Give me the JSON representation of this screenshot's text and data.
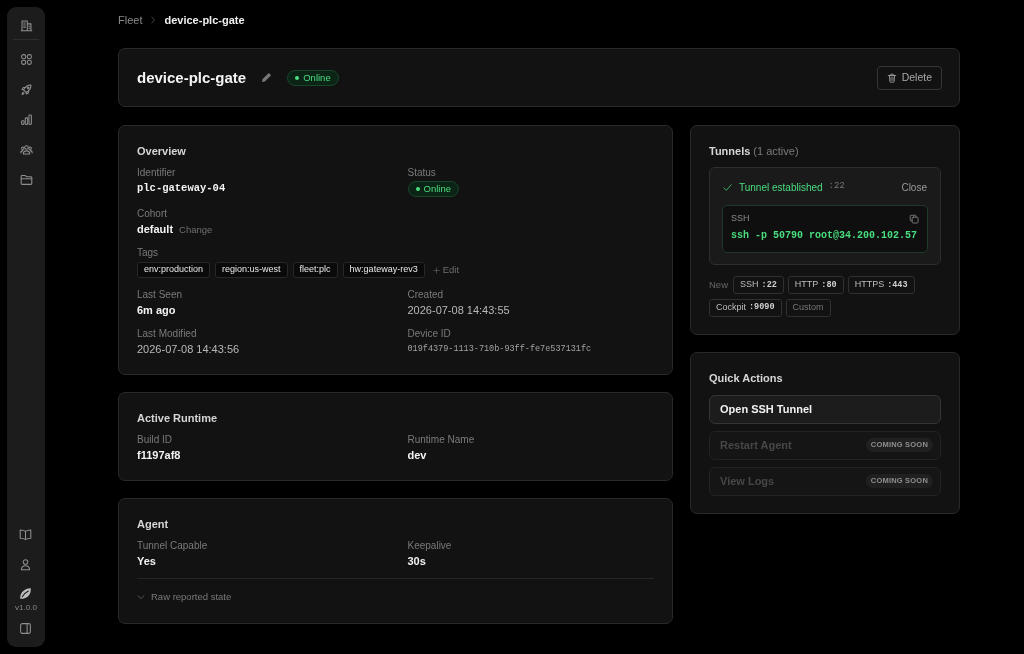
{
  "sidebar": {
    "version": "v1.0.0"
  },
  "breadcrumb": [
    {
      "label": "Fleet",
      "current": false
    },
    {
      "label": "device-plc-gate",
      "current": true
    }
  ],
  "header": {
    "title": "device-plc-gate",
    "status": "Online",
    "delete_button": "Delete"
  },
  "overview": {
    "title": "Overview",
    "rows": [
      [
        {
          "label": "Identifier",
          "value": "plc-gateway-04",
          "kind": "mono"
        },
        {
          "label": "Status",
          "value": "Online",
          "kind": "status"
        }
      ],
      [
        {
          "label": "Cohort",
          "value": "default",
          "kind": "text",
          "action": "Change"
        }
      ],
      [
        {
          "label": "Tags",
          "kind": "tags",
          "tags": [
            "env:production",
            "region:us-west",
            "fleet:plc",
            "hw:gateway-rev3"
          ],
          "action": "Edit"
        }
      ],
      [
        {
          "label": "Last Seen",
          "value": "6m ago",
          "kind": "text"
        },
        {
          "label": "Created",
          "value": "2026-07-08 14:43:55",
          "kind": "muted"
        }
      ],
      [
        {
          "label": "Last Modified",
          "value": "2026-07-08 14:43:56",
          "kind": "muted"
        },
        {
          "label": "Device ID",
          "value": "019f4379-1113-710b-93ff-fe7e537131fc",
          "kind": "code"
        }
      ]
    ]
  },
  "active_runtime": {
    "title": "Active Runtime",
    "rows": [
      [
        {
          "label": "Build ID",
          "value": "f1197af8",
          "kind": "text"
        },
        {
          "label": "Runtime Name",
          "value": "dev",
          "kind": "text"
        }
      ]
    ]
  },
  "agent": {
    "title": "Agent",
    "rows": [
      [
        {
          "label": "Tunnel Capable",
          "value": "Yes",
          "kind": "text"
        },
        {
          "label": "Keepalive",
          "value": "30s",
          "kind": "text"
        }
      ]
    ],
    "raw_state": {
      "label": "Raw reported state",
      "expanded": false
    }
  },
  "tunnels": {
    "title": "Tunnels",
    "count": "(1 active)",
    "active_tunnels": [
      {
        "status": "Tunnel established",
        "port": ":22",
        "close": "Close",
        "protocol": "SSH",
        "command": "ssh -p 50790 root@34.200.102.57"
      }
    ],
    "new_label": "New",
    "new_options": [
      {
        "label": "SSH",
        "port": ":22",
        "kind": "port"
      },
      {
        "label": "HTTP",
        "port": ":80",
        "kind": "port"
      },
      {
        "label": "HTTPS",
        "port": ":443",
        "kind": "port"
      },
      {
        "label": "Cockpit",
        "port": ":9090",
        "kind": "port"
      },
      {
        "label": "Custom",
        "kind": "custom"
      }
    ]
  },
  "quick_actions": {
    "title": "Quick Actions",
    "actions": [
      {
        "label": "Open SSH Tunnel",
        "disabled": false
      },
      {
        "label": "Restart Agent",
        "disabled": true,
        "note": "COMING SOON"
      },
      {
        "label": "View Logs",
        "disabled": true,
        "note": "COMING SOON"
      }
    ]
  }
}
